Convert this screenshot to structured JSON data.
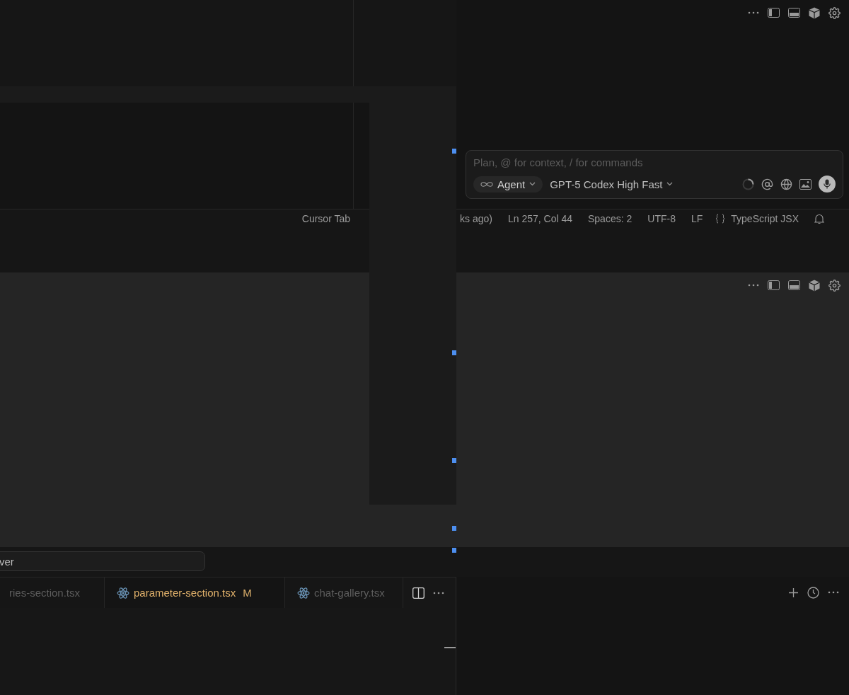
{
  "chat_input": {
    "placeholder": "Plan, @ for context, / for commands",
    "mode": "Agent",
    "model": "GPT-5 Codex High Fast"
  },
  "status_bar": {
    "left_items": [
      "Cursor Tab"
    ],
    "right_items": [
      "ks ago)",
      "Ln 257, Col 44",
      "Spaces: 2",
      "UTF-8",
      "LF"
    ],
    "language": "TypeScript JSX"
  },
  "search_field": {
    "value": "ver"
  },
  "tabs": [
    {
      "label": "ries-section.tsx",
      "selected": false,
      "icon_visible": false
    },
    {
      "label": "parameter-section.tsx",
      "selected": true,
      "icon_visible": true,
      "badge": "M"
    },
    {
      "label": "chat-gallery.tsx",
      "selected": false,
      "icon_visible": true
    }
  ]
}
